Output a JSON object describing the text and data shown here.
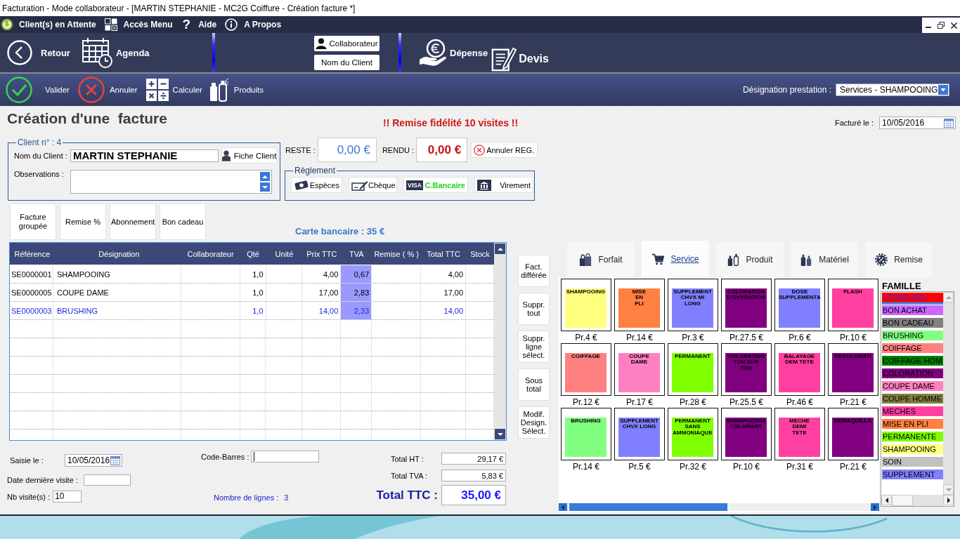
{
  "window": {
    "title": "Facturation - Mode collaborateur - [MARTIN STEPHANIE - MC2G Coiffure - Création facture *]"
  },
  "menu": [
    {
      "label": "Client(s) en Attente"
    },
    {
      "label": "Accès Menu"
    },
    {
      "glyph": "?",
      "label": "Aide"
    },
    {
      "label": "A Propos"
    }
  ],
  "nav": {
    "left": [
      {
        "label": "Retour"
      },
      {
        "label": "Agenda"
      }
    ],
    "center": [
      {
        "label": "Collaborateur"
      },
      {
        "label": "Nom du Client"
      }
    ],
    "right": [
      {
        "label": "Dépense"
      },
      {
        "label": "Devis"
      }
    ]
  },
  "actions": [
    {
      "label": "Valider"
    },
    {
      "label": "Annuler"
    },
    {
      "label": "Calculer"
    },
    {
      "label": "Produits"
    }
  ],
  "designation": {
    "label": "Désignation prestation :",
    "value": "Services - SHAMPOOING"
  },
  "heading": "Création d'une  facture",
  "notice": "!! Remise fidélité 10 visites !!",
  "invoice_date": {
    "label": "Facturé le :",
    "value": "10/05/2016"
  },
  "client": {
    "legend": "Client n° : 4",
    "name_label": "Nom du Client :",
    "name": "MARTIN STEPHANIE",
    "card_button": "Fiche Client",
    "observations_label": "Observations :"
  },
  "balance": [
    {
      "kind": "reste",
      "label": "RESTE :",
      "value": "0,00 €"
    },
    {
      "kind": "rendu",
      "label": "RENDU :",
      "value": "0,00 €"
    }
  ],
  "cancel_payment": "Annuler REG.",
  "payment": {
    "legend": "Règlement",
    "methods": [
      {
        "label": "Espèces",
        "selected": false
      },
      {
        "label": "Chèque",
        "selected": false
      },
      {
        "badge": "VISA",
        "label": "C.Bancaire",
        "selected": true
      },
      {
        "label": "Virement",
        "selected": false
      }
    ]
  },
  "function_buttons": [
    "Facture groupée",
    "Remise %",
    "Abonnement",
    "Bon cadeau"
  ],
  "payment_summary": "Carte bancaire : 35 €",
  "table": {
    "columns": [
      "Référence",
      "Désignation",
      "Collaborateur",
      "Qté",
      "Unité",
      "Prix TTC",
      "TVA",
      "Remise ( % )",
      "Total TTC",
      "Stock"
    ],
    "rows": [
      {
        "reference": "SE0000001",
        "designation": "SHAMPOOING",
        "qty": "1,0",
        "price": "4,00",
        "vat": "0,67",
        "total": "4,00",
        "selected": false
      },
      {
        "reference": "SE0000005",
        "designation": "COUPE DAME",
        "qty": "1,0",
        "price": "17,00",
        "vat": "2,83",
        "total": "17,00",
        "selected": false
      },
      {
        "reference": "SE0000003",
        "designation": "BRUSHING",
        "qty": "1,0",
        "price": "14,00",
        "vat": "2,33",
        "total": "14,00",
        "selected": true
      }
    ]
  },
  "side_buttons": [
    "Fact. différée",
    "Suppr. tout",
    "Suppr. ligne sélect.",
    "Sous total",
    "Modif. Design. Sélect."
  ],
  "visit": {
    "entry_label": "Saisie le :",
    "entry_date": "10/05/2016",
    "last_visit_label": "Date dernière visite :",
    "count_label": "Nb visite(s) :",
    "count": "10"
  },
  "barcode": {
    "label": "Code-Barres :",
    "focused": true
  },
  "line_count": {
    "label": "Nombre de lignes :",
    "value": "3"
  },
  "totals": [
    {
      "kind": "sub",
      "label": "Total HT :",
      "value": "29,17 €"
    },
    {
      "kind": "sub",
      "label": "Total TVA :",
      "value": "5,83 €"
    },
    {
      "kind": "grand",
      "label": "Total TTC :",
      "value": "35,00 €"
    }
  ],
  "catalog_tabs": [
    {
      "label": "Forfait",
      "selected": false
    },
    {
      "label": "Service",
      "selected": true
    },
    {
      "label": "Produit",
      "selected": false
    },
    {
      "label": "Matériel",
      "selected": false
    },
    {
      "label": "Remise",
      "selected": false
    }
  ],
  "tiles": [
    {
      "label": "SHAMPOOING",
      "price": "Pr.4 €",
      "color": "#ffff80"
    },
    {
      "label": "MISE EN PLI",
      "price": "Pr.14 €",
      "color": "#ff8040"
    },
    {
      "label": "SUPPLEMENT CHVX MI LONG",
      "price": "Pr.3 €",
      "color": "#8080ff"
    },
    {
      "label": "COLORATION D'OXYDATION",
      "price": "Pr.27.5 €",
      "color": "#800080"
    },
    {
      "label": "DOSE SUPPLEMENTA",
      "price": "Pr.6 €",
      "color": "#8080ff"
    },
    {
      "label": "FLASH",
      "price": "Pr.10 €",
      "color": "#ff40a0"
    },
    {
      "label": "COIFFAGE",
      "price": "Pr.12 €",
      "color": "#ff8080"
    },
    {
      "label": "COUPE DAME",
      "price": "Pr.17 €",
      "color": "#ff80c0"
    },
    {
      "label": "PERMANENT",
      "price": "Pr.28 €",
      "color": "#80ff00"
    },
    {
      "label": "COLORATION TON SUR TON",
      "price": "Pr.25.5 €",
      "color": "#800080"
    },
    {
      "label": "BALAYAGE DEM TETE",
      "price": "Pr.46 €",
      "color": "#ff40a0"
    },
    {
      "label": "DECOLORATI",
      "price": "Pr.21 €",
      "color": "#800080"
    },
    {
      "label": "BRUSHING",
      "price": "Pr.14 €",
      "color": "#80ff80"
    },
    {
      "label": "SUPPLEMENT CHVX LONG",
      "price": "Pr.5 €",
      "color": "#8080ff"
    },
    {
      "label": "PERMANENT SANS AMMONIAQUE",
      "price": "Pr.32 €",
      "color": "#80ff00"
    },
    {
      "label": "SHAMPOOING COLORANT",
      "price": "Pr.10 €",
      "color": "#800080"
    },
    {
      "label": "MECHE DEMI TETE",
      "price": "Pr.31 €",
      "color": "#ff40a0"
    },
    {
      "label": "DEMAQUILLA",
      "price": "Pr.21 €",
      "color": "#800080"
    }
  ],
  "family": {
    "title": "FAMILLE",
    "items": [
      {
        "label": "<TOTALITE>",
        "color": "#ff0000",
        "selected": true
      },
      {
        "label": "BON ACHAT",
        "color": "#cc66ff",
        "selected": false
      },
      {
        "label": "BON CADEAU",
        "color": "#808080",
        "selected": false
      },
      {
        "label": "BRUSHING",
        "color": "#80ff80",
        "selected": false
      },
      {
        "label": "COIFFAGE",
        "color": "#ff8080",
        "selected": false
      },
      {
        "label": "COIFFAGE HOM",
        "color": "#008000",
        "selected": false
      },
      {
        "label": "COLORATION",
        "color": "#800080",
        "selected": false
      },
      {
        "label": "COUPE DAME",
        "color": "#ff80c0",
        "selected": false
      },
      {
        "label": "COUPE HOMME",
        "color": "#808040",
        "selected": false
      },
      {
        "label": "MECHES",
        "color": "#ff40a0",
        "selected": false
      },
      {
        "label": "MISE EN PLI",
        "color": "#ff8040",
        "selected": false
      },
      {
        "label": "PERMANENTE",
        "color": "#80ff00",
        "selected": false
      },
      {
        "label": "SHAMPOOING",
        "color": "#ffff80",
        "selected": false
      },
      {
        "label": "SOIN",
        "color": "#c0c0c0",
        "selected": false
      },
      {
        "label": "SUPPLEMENT",
        "color": "#8080ff",
        "selected": false
      }
    ]
  }
}
